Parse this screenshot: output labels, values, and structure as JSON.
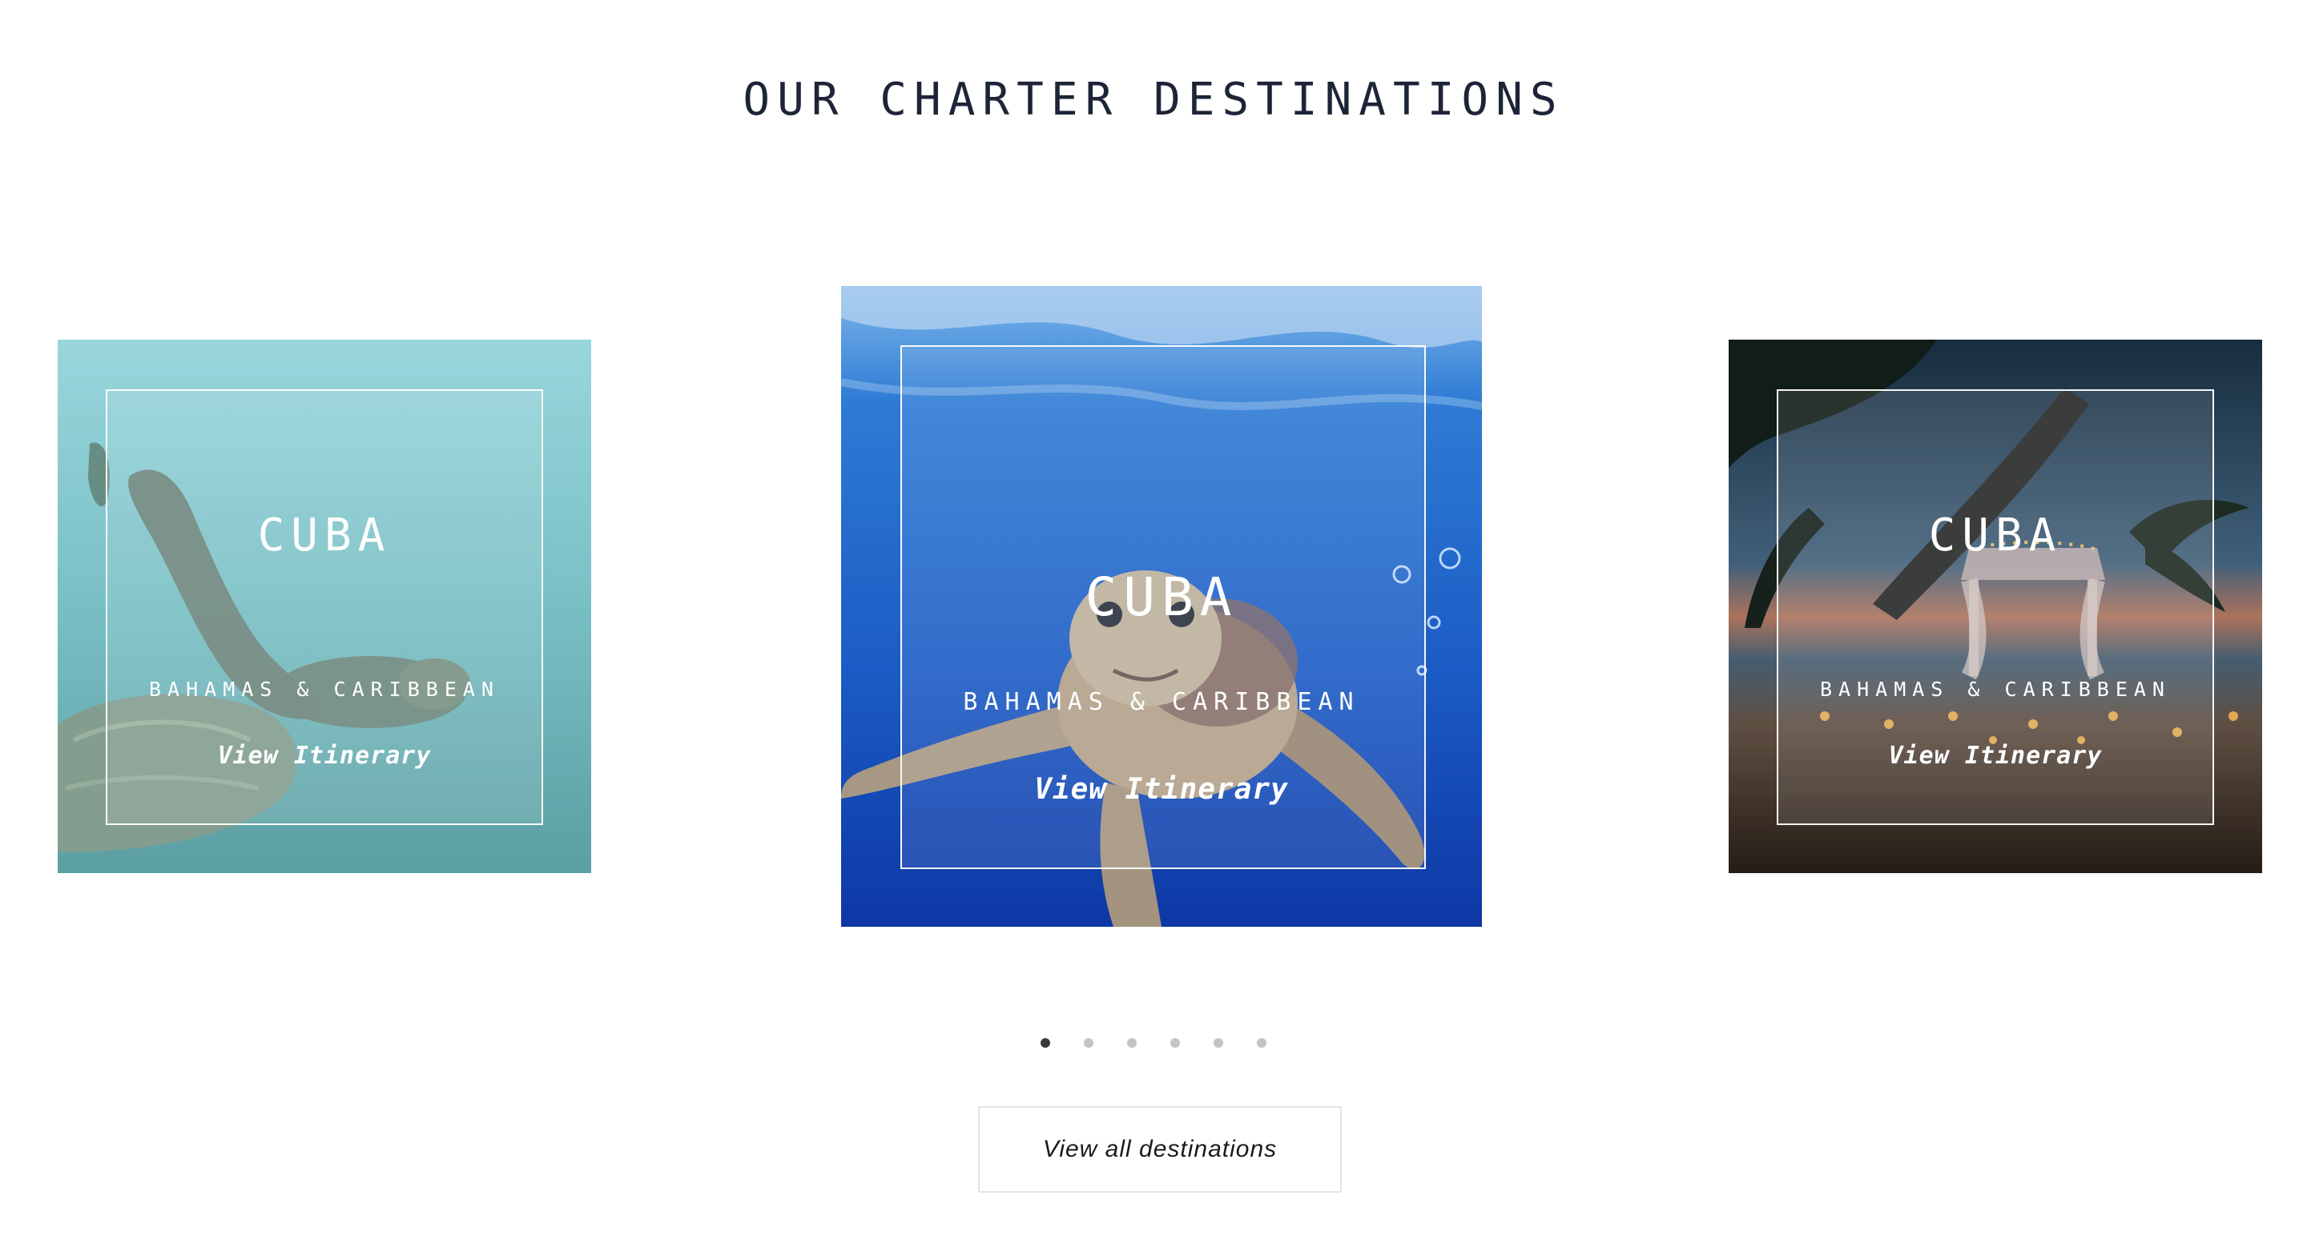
{
  "section": {
    "title": "OUR CHARTER DESTINATIONS"
  },
  "carousel": {
    "cards": [
      {
        "title": "CUBA",
        "subtitle": "BAHAMAS & CARIBBEAN",
        "link": "View Itinerary",
        "image": "sea-turtle-teal-water"
      },
      {
        "title": "CUBA",
        "subtitle": "BAHAMAS & CARIBBEAN",
        "link": "View Itinerary",
        "image": "sea-turtle-blue-ocean"
      },
      {
        "title": "CUBA",
        "subtitle": "BAHAMAS & CARIBBEAN",
        "link": "View Itinerary",
        "image": "beach-dinner-palm-trees-sunset"
      }
    ],
    "dots": {
      "count": 6,
      "active_index": 0
    }
  },
  "view_all": {
    "label": "View all destinations"
  },
  "colors": {
    "title_text": "#1e2438",
    "dot_active": "#3a3a3a",
    "dot_inactive": "#c4c4c4",
    "button_border": "#e4e4e4"
  }
}
